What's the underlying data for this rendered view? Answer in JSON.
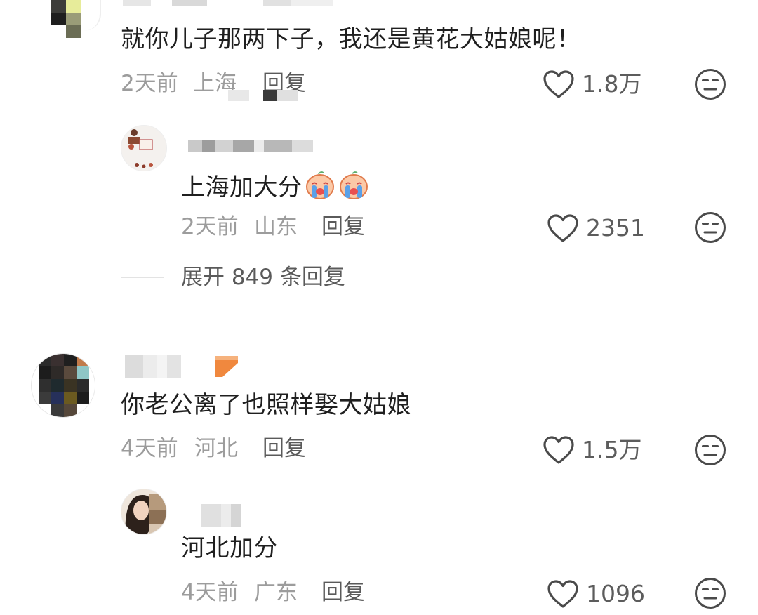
{
  "comments": [
    {
      "text": "就你儿子那两下子，我还是黄花大姑娘呢！",
      "time": "2天前",
      "location": "上海",
      "reply_label": "回复",
      "likes": "1.8万",
      "reply": {
        "text": "上海加大分",
        "inline_emoji": "crying-face-emoji",
        "time": "2天前",
        "location": "山东",
        "reply_label": "回复",
        "likes": "2351"
      },
      "expand_label": "展开 849 条回复"
    },
    {
      "text": "你老公离了也照样娶大姑娘",
      "time": "4天前",
      "location": "河北",
      "reply_label": "回复",
      "likes": "1.5万",
      "reply": {
        "text": "河北加分",
        "time": "4天前",
        "location": "广东",
        "reply_label": "回复",
        "likes": "1096"
      }
    }
  ],
  "icons": {
    "like": "heart-outline-icon",
    "dislike": "neutral-face-icon"
  },
  "colors": {
    "text_primary": "#1f1f1f",
    "text_meta": "#9c9c9c",
    "text_action": "#5a5a5a",
    "icon_stroke": "#4a4a4a",
    "badge_orange": "#f0883e"
  }
}
